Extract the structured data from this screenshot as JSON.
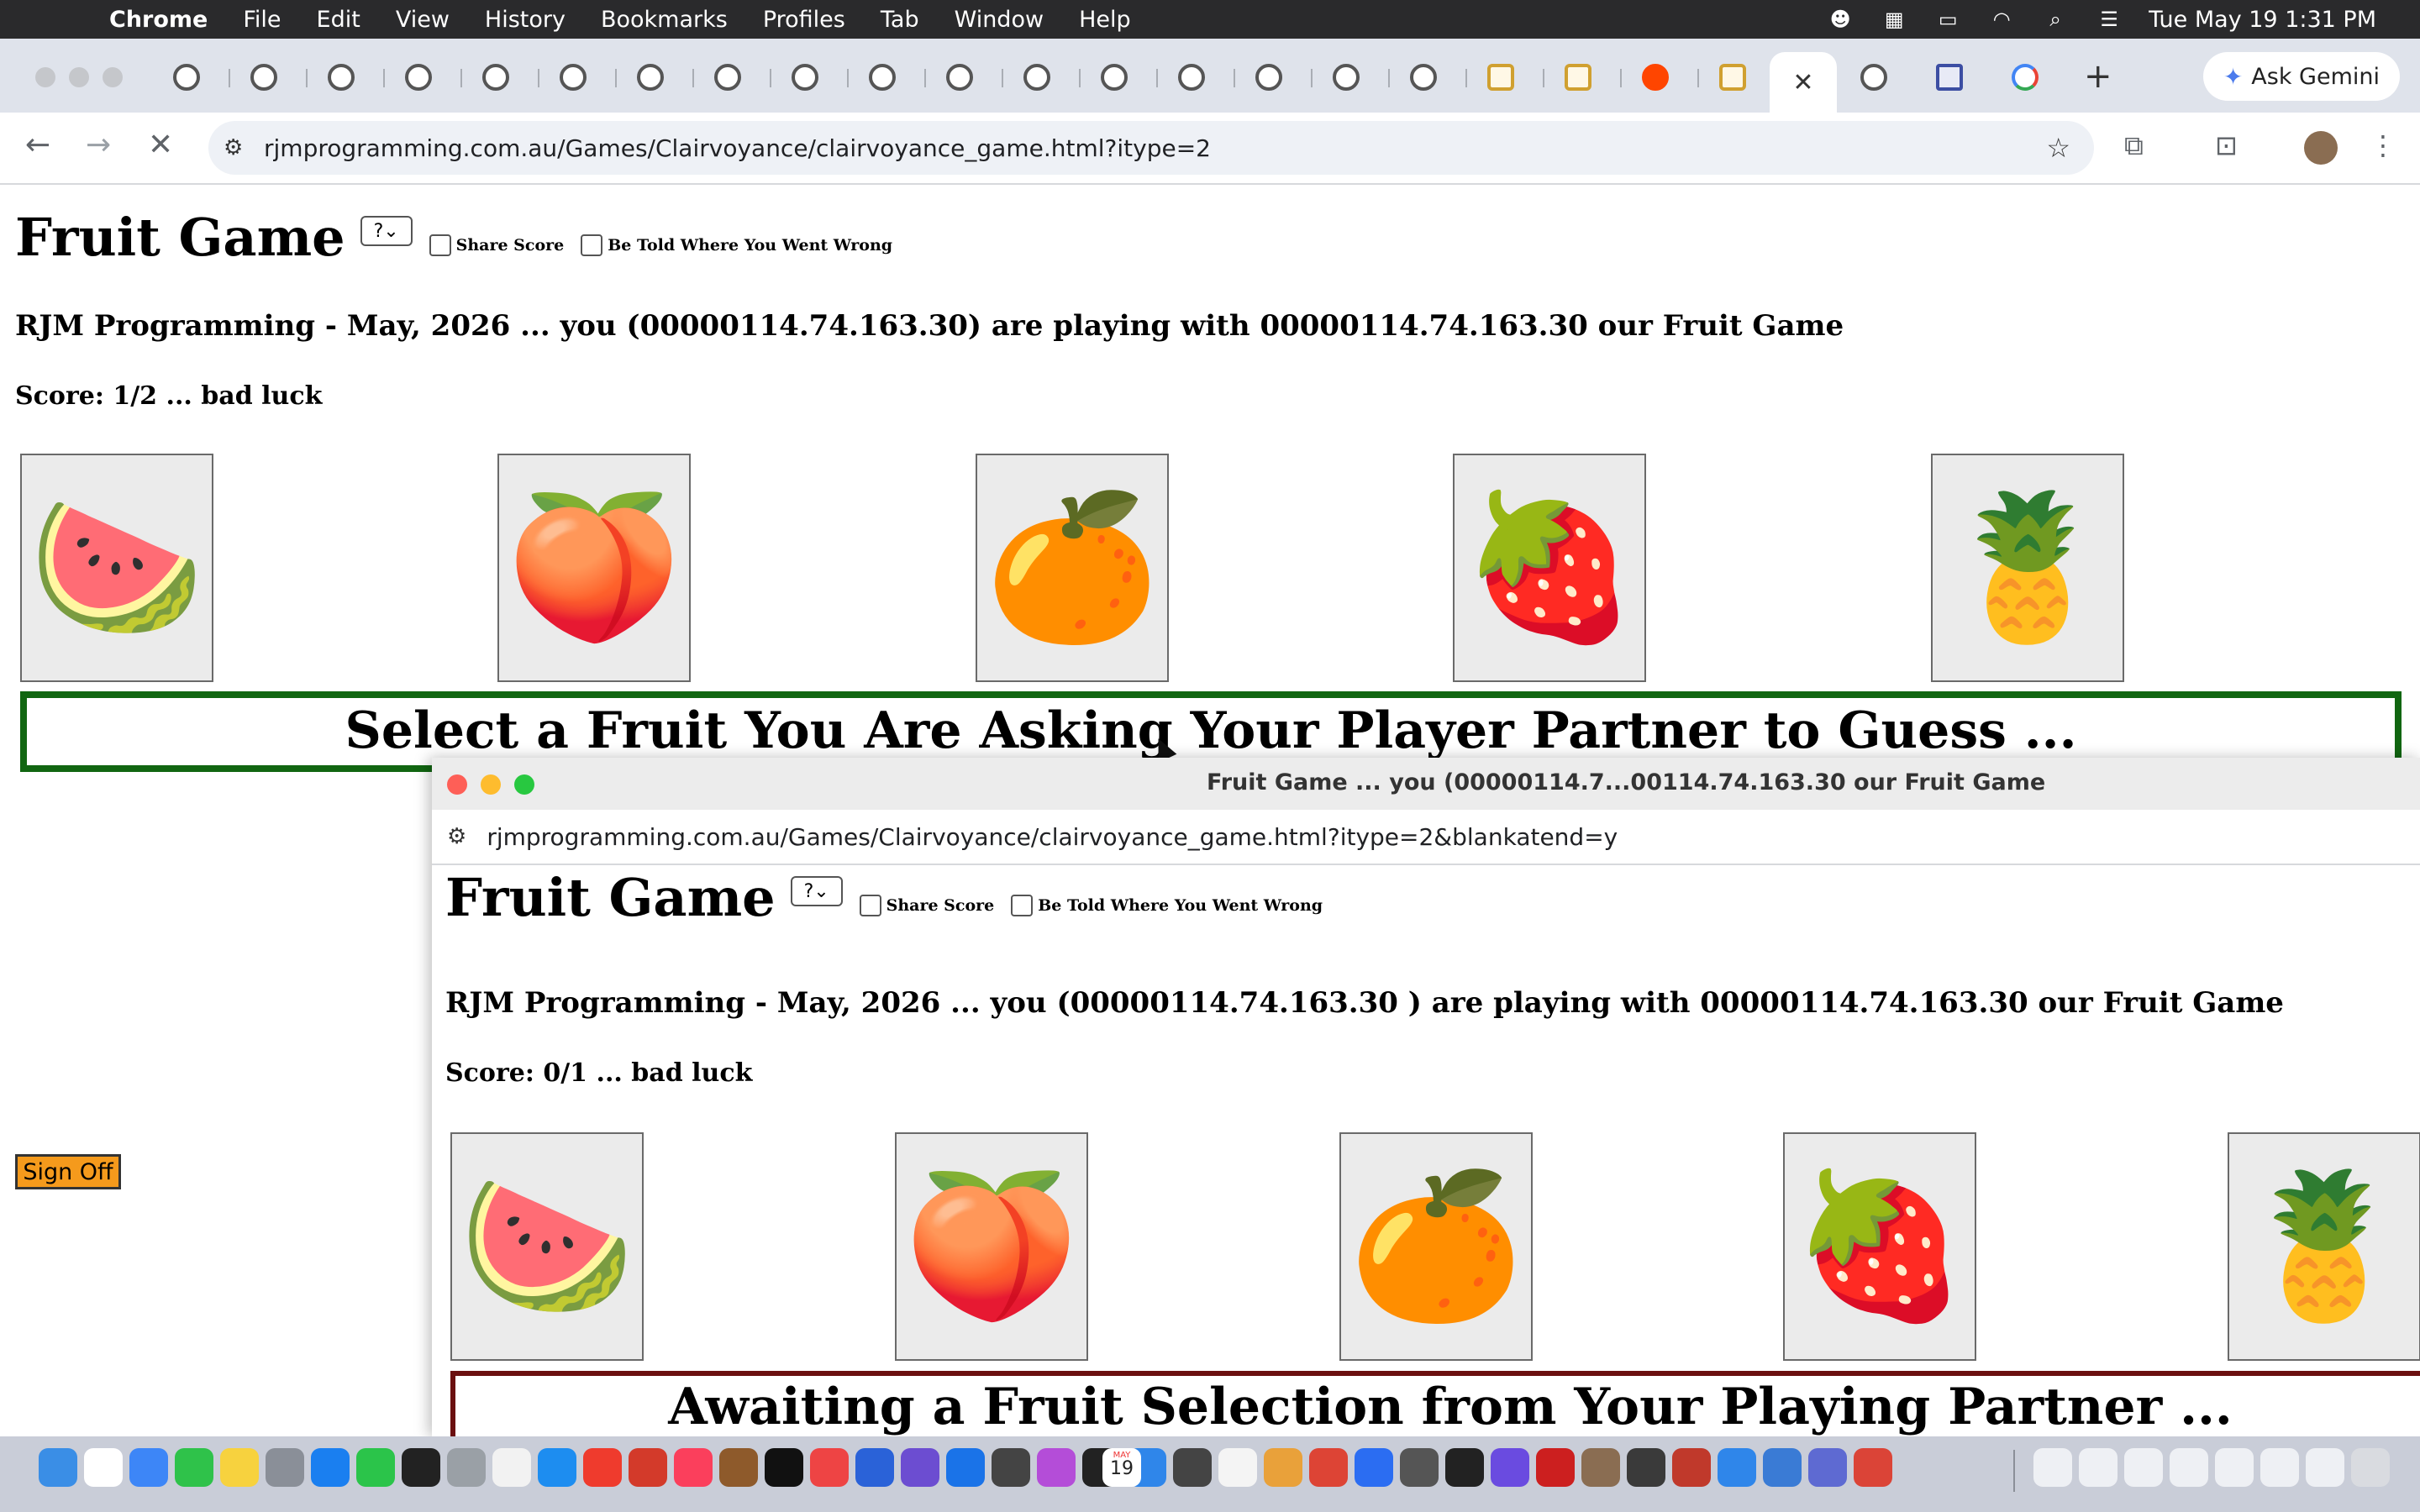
{
  "menubar": {
    "app": "Chrome",
    "items": [
      "File",
      "Edit",
      "View",
      "History",
      "Bookmarks",
      "Profiles",
      "Tab",
      "Window",
      "Help"
    ],
    "clock": "Tue May 19  1:31 PM"
  },
  "browser": {
    "active_tab_close": "✕",
    "new_tab": "+",
    "ask_gemini": "Ask Gemini",
    "url": "rjmprogramming.com.au/Games/Clairvoyance/clairvoyance_game.html?itype=2"
  },
  "main": {
    "title": "Fruit Game",
    "select_value": "?",
    "share_score_label": "Share Score",
    "told_wrong_label": "Be Told Where You Went Wrong",
    "subtitle": "RJM Programming - May, 2026 ... you (00000114.74.163.30) are playing with 00000114.74.163.30 our Fruit Game",
    "score": "Score: 1/2 ... bad luck",
    "fruits": [
      "🍉",
      "🍑",
      "🍊",
      "🍓",
      "🍍"
    ],
    "banner": "Select a Fruit You Are Asking Your Player Partner to Guess ...",
    "sign_off": "Sign Off"
  },
  "popup": {
    "window_title": "Fruit Game ... you (00000114.7...00114.74.163.30 our Fruit Game",
    "url": "rjmprogramming.com.au/Games/Clairvoyance/clairvoyance_game.html?itype=2&blankatend=y",
    "title": "Fruit Game",
    "select_value": "?",
    "share_score_label": "Share Score",
    "told_wrong_label": "Be Told Where You Went Wrong",
    "subtitle": "RJM Programming - May, 2026 ... you (00000114.74.163.30 ) are playing with 00000114.74.163.30 our Fruit Game",
    "score": "Score: 0/1 ... bad luck",
    "fruits": [
      "🍉",
      "🍑",
      "🍊",
      "🍓",
      "🍍"
    ],
    "banner": "Awaiting a Fruit Selection from Your Playing Partner ..."
  },
  "dock": {
    "calendar_month": "MAY",
    "calendar_day": "19"
  }
}
